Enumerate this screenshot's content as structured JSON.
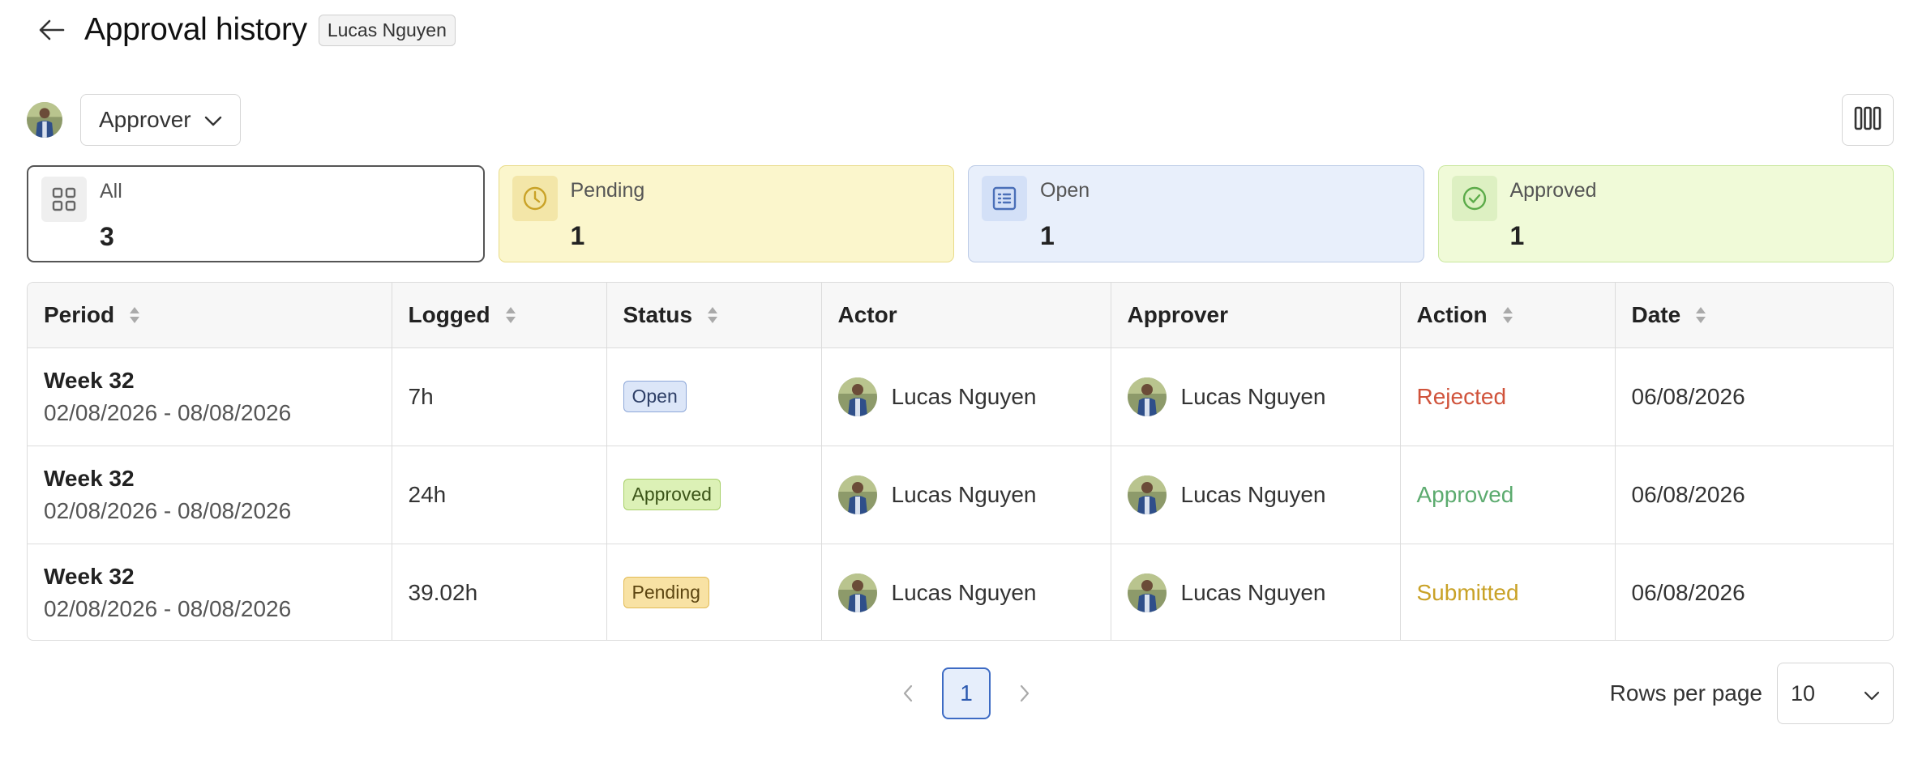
{
  "header": {
    "title": "Approval history",
    "user_badge": "Lucas Nguyen"
  },
  "filter": {
    "role_dropdown": "Approver"
  },
  "stats": [
    {
      "label": "All",
      "value": "3",
      "icon": "grid-icon"
    },
    {
      "label": "Pending",
      "value": "1",
      "icon": "clock-icon"
    },
    {
      "label": "Open",
      "value": "1",
      "icon": "list-icon"
    },
    {
      "label": "Approved",
      "value": "1",
      "icon": "check-circle-icon"
    }
  ],
  "table": {
    "columns": [
      {
        "label": "Period",
        "sortable": true
      },
      {
        "label": "Logged",
        "sortable": true
      },
      {
        "label": "Status",
        "sortable": true
      },
      {
        "label": "Actor",
        "sortable": false
      },
      {
        "label": "Approver",
        "sortable": false
      },
      {
        "label": "Action",
        "sortable": true
      },
      {
        "label": "Date",
        "sortable": true
      }
    ],
    "rows": [
      {
        "week": "Week 32",
        "range": "02/08/2026 - 08/08/2026",
        "logged": "7h",
        "status": "Open",
        "actor": "Lucas Nguyen",
        "approver": "Lucas Nguyen",
        "action": "Rejected",
        "date": "06/08/2026"
      },
      {
        "week": "Week 32",
        "range": "02/08/2026 - 08/08/2026",
        "logged": "24h",
        "status": "Approved",
        "actor": "Lucas Nguyen",
        "approver": "Lucas Nguyen",
        "action": "Approved",
        "date": "06/08/2026"
      },
      {
        "week": "Week 32",
        "range": "02/08/2026 - 08/08/2026",
        "logged": "39.02h",
        "status": "Pending",
        "actor": "Lucas Nguyen",
        "approver": "Lucas Nguyen",
        "action": "Submitted",
        "date": "06/08/2026"
      }
    ]
  },
  "pagination": {
    "current_page": "1"
  },
  "rows_per_page": {
    "label": "Rows per page",
    "value": "10"
  },
  "colors": {
    "pending_bg": "#fbf6cc",
    "open_bg": "#e8effb",
    "approved_bg": "#f0fad8",
    "rejected": "#d0533b",
    "approved": "#5cab6f",
    "submitted": "#c9a227",
    "accent": "#3d6bc4"
  }
}
